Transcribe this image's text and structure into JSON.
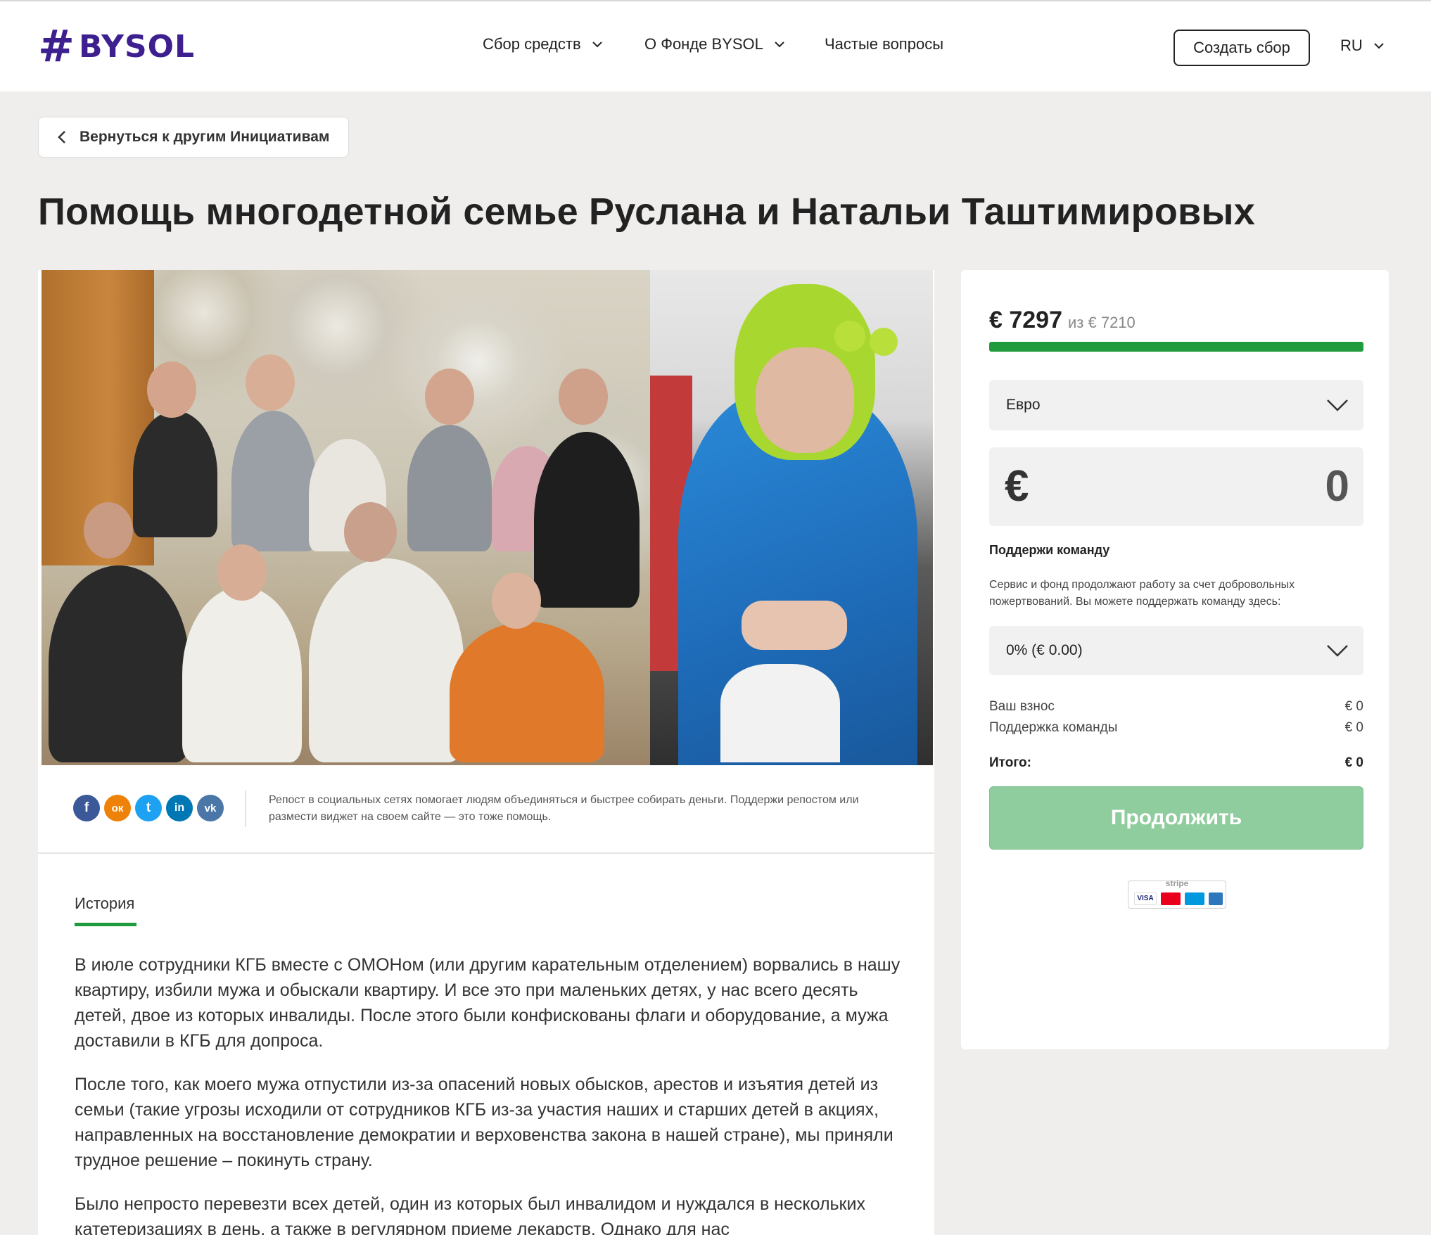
{
  "header": {
    "logo_hash": "#",
    "logo_text": "BYSOL",
    "nav": [
      {
        "label": "Сбор средств"
      },
      {
        "label": "О Фонде BYSOL"
      },
      {
        "label": "Частые вопросы"
      }
    ],
    "create_label": "Создать сбор",
    "lang": "RU"
  },
  "back_label": "Вернуться к другим Инициативам",
  "title": "Помощь многодетной семье Руслана и Натальи Таштимировых",
  "share": {
    "text": "Репост в социальных сетях помогает людям объединяться и быстрее собирать деньги. Поддержи репостом или размести виджет на своем сайте — это тоже помощь.",
    "icons": [
      {
        "name": "facebook-icon",
        "glyph": "f",
        "color": "#3b5998"
      },
      {
        "name": "odnoklassniki-icon",
        "glyph": "ок",
        "color": "#ee8208"
      },
      {
        "name": "twitter-icon",
        "glyph": "t",
        "color": "#1da1f2"
      },
      {
        "name": "linkedin-icon",
        "glyph": "in",
        "color": "#0077b5"
      },
      {
        "name": "vk-icon",
        "glyph": "vk",
        "color": "#4a76a8"
      }
    ]
  },
  "tab_label": "История",
  "story": [
    "В июле сотрудники КГБ вместе с ОМОНом (или другим карательным отделением) ворвались в нашу квартиру, избили мужа и обыскали квартиру. И все это при маленьких детях, у нас всего десять детей, двое из которых инвалиды. После этого были конфискованы флаги и оборудование, а  мужа доставили в КГБ для допроса.",
    "После того, как моего мужа отпустили из-за опасений новых обысков, арестов и изъятия детей из семьи (такие угрозы исходили от сотрудников КГБ из-за участия наших и старших детей в акциях, направленных на восстановление демократии и верховенства закона в нашей стране), мы приняли трудное решение – покинуть страну.",
    "Было непросто перевезти всех детей, один из которых был инвалидом и нуждался в нескольких катетеризациях в день, а также в регулярном приеме лекарств. Однако для нас"
  ],
  "donate": {
    "raised": "€ 7297",
    "goal_text": "из € 7210",
    "progress": 1.0,
    "currency": "Евро",
    "amount_symbol": "€",
    "amount_value": "0",
    "support_title": "Поддержи команду",
    "support_text": "Сервис и фонд продолжают работу за счет добровольных пожертвований. Вы можете поддержать команду здесь:",
    "tip_option": "0% (€ 0.00)",
    "rows": [
      {
        "label": "Ваш взнос",
        "value": "€ 0"
      },
      {
        "label": "Поддержка команды",
        "value": "€ 0"
      }
    ],
    "total_label": "Итого:",
    "total_value": "€ 0",
    "continue_label": "Продолжить",
    "stripe_label": "stripe"
  },
  "colors": {
    "brand": "#3d1f8f",
    "accent_green": "#1f9b3d",
    "button_disabled": "#8fcc9e"
  }
}
